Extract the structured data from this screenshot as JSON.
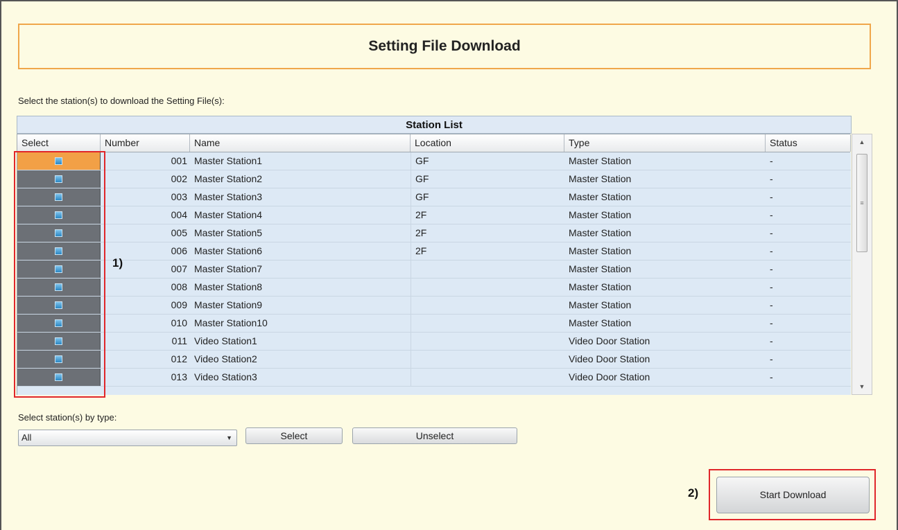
{
  "page": {
    "title": "Setting File Download",
    "instruction": "Select the station(s) to download the Setting File(s):"
  },
  "station_list": {
    "header": "Station List",
    "columns": [
      "Select",
      "Number",
      "Name",
      "Location",
      "Type",
      "Status"
    ],
    "rows": [
      {
        "number": "001",
        "name": "Master Station1",
        "location": "GF",
        "type": "Master Station",
        "status": "-"
      },
      {
        "number": "002",
        "name": "Master Station2",
        "location": "GF",
        "type": "Master Station",
        "status": "-"
      },
      {
        "number": "003",
        "name": "Master Station3",
        "location": "GF",
        "type": "Master Station",
        "status": "-"
      },
      {
        "number": "004",
        "name": "Master Station4",
        "location": "2F",
        "type": "Master Station",
        "status": "-"
      },
      {
        "number": "005",
        "name": "Master Station5",
        "location": "2F",
        "type": "Master Station",
        "status": "-"
      },
      {
        "number": "006",
        "name": "Master Station6",
        "location": "2F",
        "type": "Master Station",
        "status": "-"
      },
      {
        "number": "007",
        "name": "Master Station7",
        "location": "",
        "type": "Master Station",
        "status": "-"
      },
      {
        "number": "008",
        "name": "Master Station8",
        "location": "",
        "type": "Master Station",
        "status": "-"
      },
      {
        "number": "009",
        "name": "Master Station9",
        "location": "",
        "type": "Master Station",
        "status": "-"
      },
      {
        "number": "010",
        "name": "Master Station10",
        "location": "",
        "type": "Master Station",
        "status": "-"
      },
      {
        "number": "011",
        "name": "Video Station1",
        "location": "",
        "type": "Video Door Station",
        "status": "-"
      },
      {
        "number": "012",
        "name": "Video Station2",
        "location": "",
        "type": "Video Door Station",
        "status": "-"
      },
      {
        "number": "013",
        "name": "Video Station3",
        "location": "",
        "type": "Video Door Station",
        "status": "-"
      }
    ]
  },
  "callouts": {
    "one": "1)",
    "two": "2)"
  },
  "filter": {
    "label": "Select station(s) by type:",
    "selected": "All",
    "select_button": "Select",
    "unselect_button": "Unselect"
  },
  "actions": {
    "start_download": "Start Download"
  },
  "colors": {
    "highlight": "#e0262a",
    "title_border": "#f0a64a",
    "active_select": "#f2a046"
  }
}
